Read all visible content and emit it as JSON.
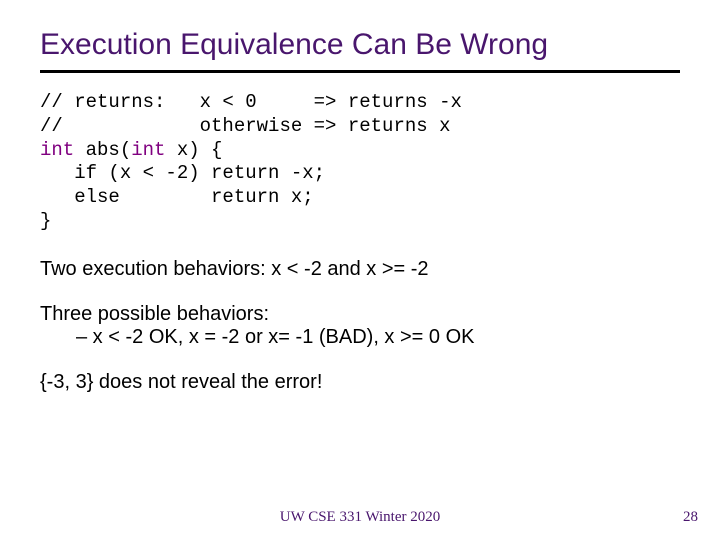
{
  "title": "Execution Equivalence Can Be Wrong",
  "code": {
    "l1a": "// returns:   x < 0     => returns -x",
    "l2a": "//            otherwise => returns x",
    "l3_kw1": "int",
    "l3_mid": " abs(",
    "l3_kw2": "int",
    "l3_end": " x) {",
    "l4": "   if (x < -2) return -x;",
    "l5": "   else        return x;",
    "l6": "}"
  },
  "para1": "Two execution behaviors: x < -2 and x >= -2",
  "para2": "Three possible behaviors:",
  "para2sub": "–  x < -2 OK,   x = -2 or x= -1 (BAD),   x >= 0 OK",
  "para3": "{-3, 3} does not reveal the error!",
  "footer": "UW CSE 331 Winter 2020",
  "page": "28"
}
